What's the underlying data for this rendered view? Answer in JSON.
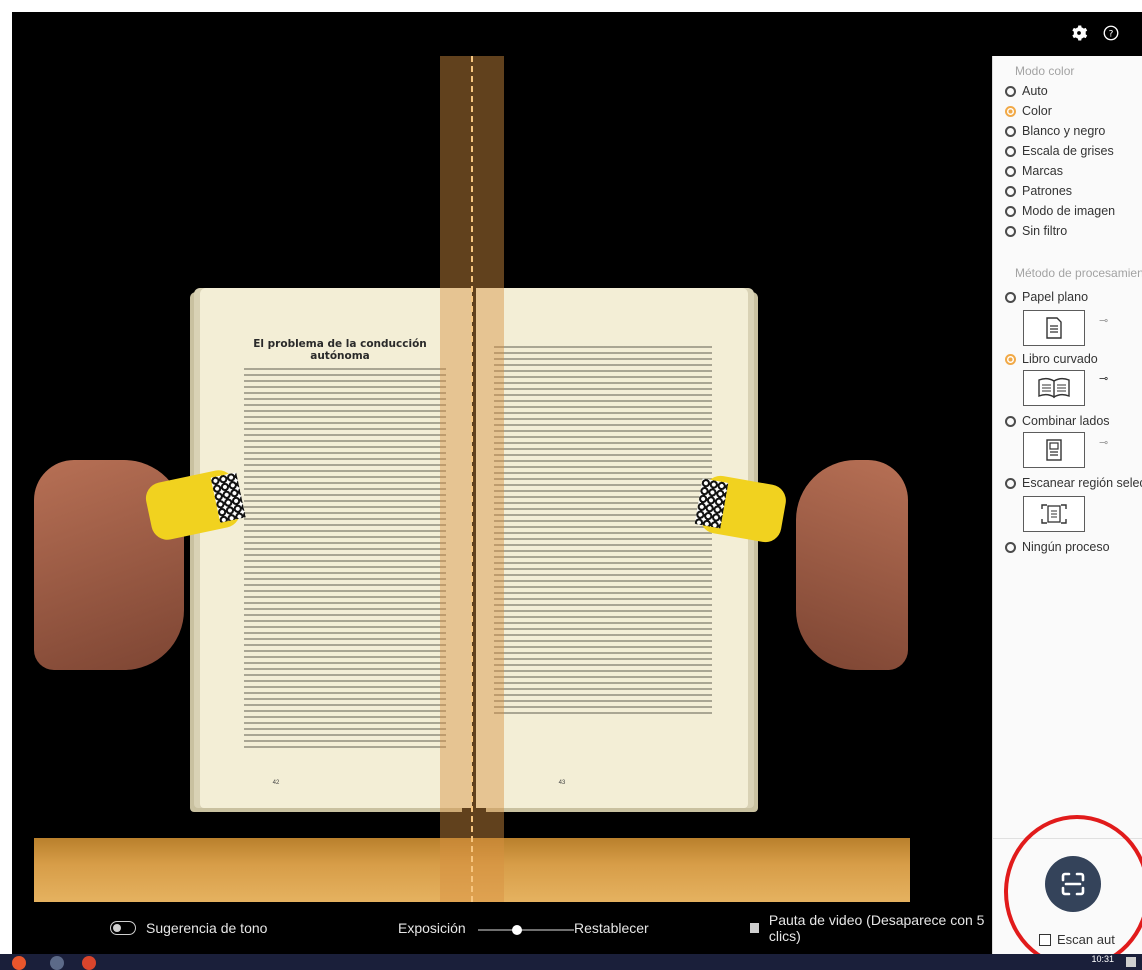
{
  "top_bar": {
    "settings_icon": "gear-icon",
    "help_icon": "help-circle-icon",
    "help_glyph": "?"
  },
  "viewer": {
    "book": {
      "left_page_title": "El problema de la conducción autónoma",
      "left_page_number": "42",
      "right_page_number": "43"
    }
  },
  "bottom_bar": {
    "tone_hint_label": "Sugerencia de tono",
    "exposure_label": "Exposición",
    "exposure_level": 0.4,
    "reset_label": "Restablecer",
    "video_guide_label": "Pauta de video  (Desaparece con 5  clics)"
  },
  "panel": {
    "color_mode": {
      "title": "Modo color",
      "selected": "Color",
      "options": [
        "Auto",
        "Color",
        "Blanco y negro",
        "Escala de grises",
        "Marcas",
        "Patrones",
        "Modo de imagen",
        "Sin filtro"
      ]
    },
    "processing": {
      "title": "Método de procesamiento",
      "selected": "Libro curvado",
      "options": [
        "Papel plano",
        "Libro curvado",
        "Combinar lados",
        "Escanear región selec...",
        "Ningún proceso"
      ]
    },
    "scan": {
      "button_icon": "scan-frame-icon",
      "auto_label": "Escan aut",
      "auto_checked": false
    }
  },
  "taskbar": {
    "time": "10:31"
  },
  "colors": {
    "accent": "#f1a947",
    "scan_button": "#34435a",
    "highlight_ring": "#e11b1b",
    "guide_line": "#f7c57e"
  }
}
